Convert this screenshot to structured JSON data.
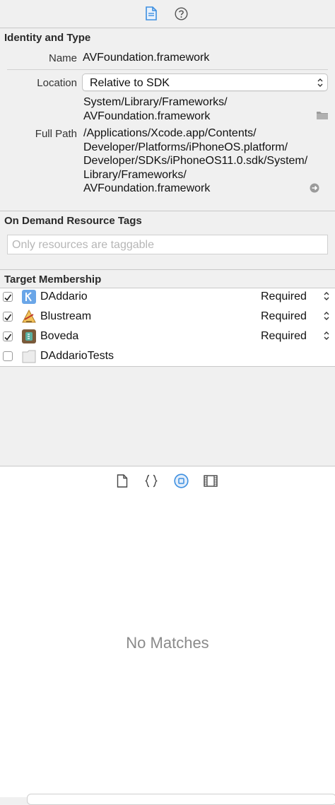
{
  "inspector_tabs": [
    {
      "icon": "file-icon",
      "selected": true
    },
    {
      "icon": "help-icon",
      "selected": false
    }
  ],
  "identity": {
    "title": "Identity and Type",
    "name_label": "Name",
    "name_value": "AVFoundation.framework",
    "location_label": "Location",
    "location_value": "Relative to SDK",
    "location_path_1": "System/Library/Frameworks/",
    "location_path_2": "AVFoundation.framework",
    "fullpath_label": "Full Path",
    "fullpath_lines": [
      "/Applications/Xcode.app/Contents/",
      "Developer/Platforms/iPhoneOS.platform/",
      "Developer/SDKs/iPhoneOS11.0.sdk/System/",
      "Library/Frameworks/",
      "AVFoundation.framework"
    ]
  },
  "odr": {
    "title": "On Demand Resource Tags",
    "placeholder": "Only resources are taggable"
  },
  "targets": {
    "title": "Target Membership",
    "items": [
      {
        "name": "DAddario",
        "checked": true,
        "membership": "Required",
        "icon": "app-target-icon",
        "color": "#6aa6e8"
      },
      {
        "name": "Blustream",
        "checked": true,
        "membership": "Required",
        "icon": "xcode-target-icon",
        "color": "#e0a030"
      },
      {
        "name": "Boveda",
        "checked": true,
        "membership": "Required",
        "icon": "app-target-icon",
        "color": "#7a5a3a"
      },
      {
        "name": "DAddarioTests",
        "checked": false,
        "membership": "",
        "icon": "test-bundle-icon",
        "color": "#e6e6e6"
      }
    ]
  },
  "library_tabs": [
    {
      "icon": "file-template-icon",
      "selected": false
    },
    {
      "icon": "code-snippet-icon",
      "selected": false
    },
    {
      "icon": "object-library-icon",
      "selected": true
    },
    {
      "icon": "media-library-icon",
      "selected": false
    }
  ],
  "library": {
    "empty_text": "No Matches"
  },
  "colors": {
    "accent": "#3d8fe0",
    "panel": "#f0f0f0"
  }
}
